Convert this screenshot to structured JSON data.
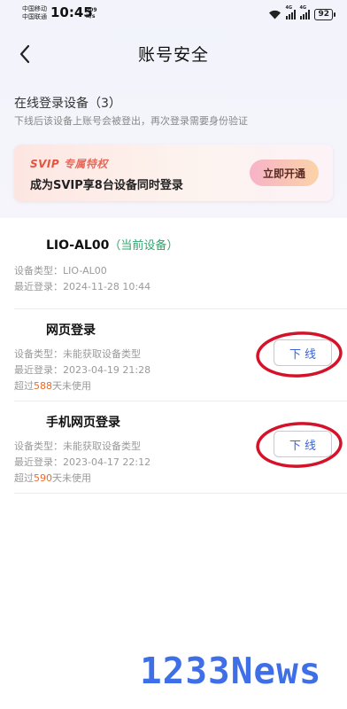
{
  "status_bar": {
    "carrier1": "中国移动",
    "carrier2": "中国联通",
    "time": "10:45",
    "net_speed_value": "209",
    "net_speed_unit": "K/s",
    "sig1_label": "4G",
    "sig2_label": "4G",
    "battery": "92"
  },
  "nav": {
    "title": "账号安全"
  },
  "section": {
    "title": "在线登录设备（3）",
    "desc": "下线后该设备上账号会被登出，再次登录需要身份验证"
  },
  "svip": {
    "tag_latin": "SVIP",
    "tag_zh": "专属特权",
    "text": "成为SVIP享8台设备同时登录",
    "button": "立即开通",
    "accent": "#e2543f"
  },
  "devices": [
    {
      "name": "LIO-AL00",
      "current_tag": "（当前设备）",
      "type_line": "设备类型：LIO-AL00",
      "recent_line": "最近登录：2024-11-28 10:44"
    },
    {
      "name": "网页登录",
      "type_line": "设备类型：未能获取设备类型",
      "recent_line": "最近登录：2023-04-19 21:28",
      "unused_prefix": "超过",
      "unused_days": "588",
      "unused_suffix": "天未使用",
      "button": "下线"
    },
    {
      "name": "手机网页登录",
      "type_line": "设备类型：未能获取设备类型",
      "recent_line": "最近登录：2023-04-17 22:12",
      "unused_prefix": "超过",
      "unused_days": "590",
      "unused_suffix": "天未使用",
      "button": "下线"
    }
  ],
  "watermark": "1233News",
  "colors": {
    "current": "#2fa56c",
    "days": "#ee6a2a",
    "button_text": "#3a64d8",
    "annotation": "#d4122a",
    "watermark": "#3f6fe6"
  }
}
